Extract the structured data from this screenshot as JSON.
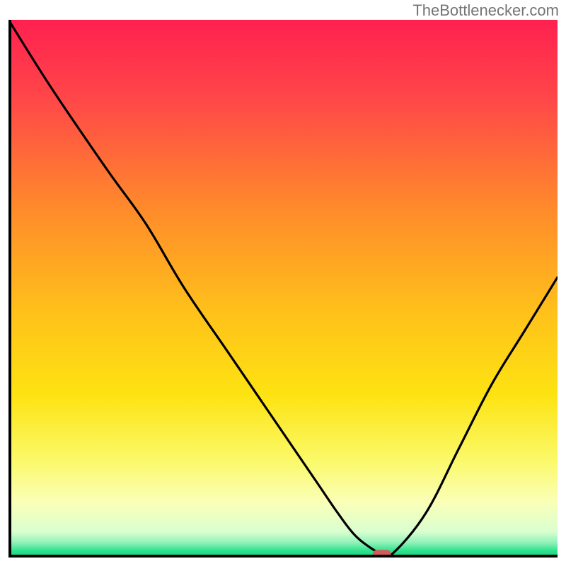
{
  "watermark": "TheBottlenecker.com",
  "chart_data": {
    "type": "line",
    "title": "",
    "xlabel": "",
    "ylabel": "",
    "xlim": [
      0,
      100
    ],
    "ylim": [
      0,
      100
    ],
    "gradient_stops": [
      {
        "offset": 0.0,
        "color": "#ff2050"
      },
      {
        "offset": 0.15,
        "color": "#ff4848"
      },
      {
        "offset": 0.35,
        "color": "#ff8a2b"
      },
      {
        "offset": 0.55,
        "color": "#ffc21a"
      },
      {
        "offset": 0.7,
        "color": "#fde312"
      },
      {
        "offset": 0.82,
        "color": "#fbf968"
      },
      {
        "offset": 0.9,
        "color": "#faffb8"
      },
      {
        "offset": 0.955,
        "color": "#d9ffd0"
      },
      {
        "offset": 0.975,
        "color": "#8ff2b8"
      },
      {
        "offset": 0.99,
        "color": "#2ee28e"
      },
      {
        "offset": 1.0,
        "color": "#17d880"
      }
    ],
    "series": [
      {
        "name": "curve",
        "x": [
          0,
          8,
          18,
          25,
          32,
          40,
          48,
          56,
          60,
          63,
          66,
          68,
          70,
          76,
          82,
          88,
          94,
          100
        ],
        "y": [
          100,
          87,
          72,
          62,
          50,
          38,
          26,
          14,
          8,
          4,
          1.5,
          0.5,
          0.5,
          8,
          20,
          32,
          42,
          52
        ]
      }
    ],
    "marker": {
      "x": 68,
      "y": 0.3
    },
    "axes": {
      "color": "#000000",
      "width": 4
    }
  }
}
